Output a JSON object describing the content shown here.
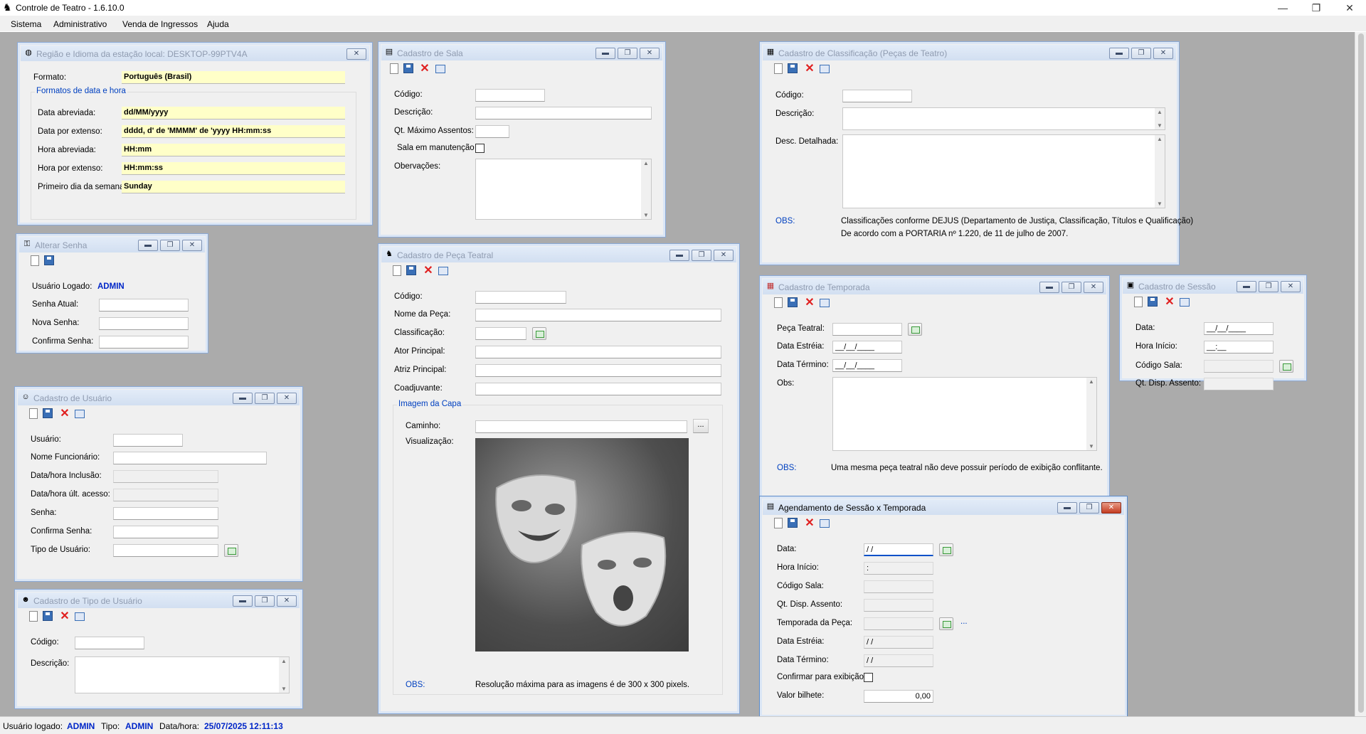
{
  "app": {
    "title": "Controle de Teatro - 1.6.10.0",
    "menu": [
      "Sistema",
      "Administrativo",
      "Venda de Ingressos",
      "Ajuda"
    ]
  },
  "status": {
    "user_label": "Usuário logado:",
    "user": "ADMIN",
    "type_label": "Tipo:",
    "type": "ADMIN",
    "datetime_label": "Data/hora:",
    "datetime": "25/07/2025 12:11:13"
  },
  "regiao": {
    "title": "Região e Idioma da estação local: DESKTOP-99PTV4A",
    "formato_label": "Formato:",
    "formato": "Português (Brasil)",
    "group_title": "Formatos de data e hora",
    "data_abreviada_label": "Data abreviada:",
    "data_abreviada": "dd/MM/yyyy",
    "data_extenso_label": "Data por extenso:",
    "data_extenso": "dddd, d' de 'MMMM' de 'yyyy HH:mm:ss",
    "hora_abreviada_label": "Hora abreviada:",
    "hora_abreviada": "HH:mm",
    "hora_extenso_label": "Hora por extenso:",
    "hora_extenso": "HH:mm:ss",
    "primeiro_dia_label": "Primeiro dia da semana:",
    "primeiro_dia": "Sunday"
  },
  "sala": {
    "title": "Cadastro de Sala",
    "codigo_label": "Código:",
    "descricao_label": "Descrição:",
    "qt_max_label": "Qt. Máximo Assentos:",
    "manutencao_label": "Sala em manutenção",
    "observacoes_label": "Obervações:"
  },
  "classificacao": {
    "title": "Cadastro de Classificação (Peças de Teatro)",
    "codigo_label": "Código:",
    "descricao_label": "Descrição:",
    "desc_detalhada_label": "Desc. Detalhada:",
    "obs_label": "OBS:",
    "obs_line1": "Classificações conforme DEJUS (Departamento de Justiça, Classificação, Títulos e Qualificação)",
    "obs_line2": "De acordo com a PORTARIA nº 1.220, de 11 de julho de 2007."
  },
  "senha": {
    "title": "Alterar Senha",
    "usuario_label": "Usuário Logado:",
    "usuario": "ADMIN",
    "atual_label": "Senha Atual:",
    "nova_label": "Nova Senha:",
    "confirma_label": "Confirma Senha:"
  },
  "peca": {
    "title": "Cadastro de Peça Teatral",
    "codigo_label": "Código:",
    "nome_label": "Nome da Peça:",
    "classificacao_label": "Classificação:",
    "ator_label": "Ator Principal:",
    "atriz_label": "Atriz Principal:",
    "coadjuvante_label": "Coadjuvante:",
    "imagem_group": "Imagem da Capa",
    "caminho_label": "Caminho:",
    "browse": "...",
    "visualizacao_label": "Visualização:",
    "obs_label": "OBS:",
    "obs_text": "Resolução máxima para as imagens é de 300 x 300 pixels."
  },
  "temporada": {
    "title": "Cadastro de Temporada",
    "peca_label": "Peça Teatral:",
    "estreia_label": "Data Estréia:",
    "estreia": "__/__/____",
    "termino_label": "Data Término:",
    "termino": "__/__/____",
    "obs_field_label": "Obs:",
    "obs_label": "OBS:",
    "obs_text": "Uma mesma peça teatral não deve possuir período de exibição conflitante."
  },
  "sessao": {
    "title": "Cadastro de Sessão",
    "data_label": "Data:",
    "data": "__/__/____",
    "hora_label": "Hora Início:",
    "hora": "__:__",
    "codigo_sala_label": "Código Sala:",
    "qt_disp_label": "Qt. Disp. Assento:"
  },
  "usuario": {
    "title": "Cadastro de Usuário",
    "usuario_label": "Usuário:",
    "nome_label": "Nome Funcionário:",
    "inclusao_label": "Data/hora Inclusão:",
    "ult_acesso_label": "Data/hora últ. acesso:",
    "senha_label": "Senha:",
    "confirma_label": "Confirma Senha:",
    "tipo_label": "Tipo de Usuário:"
  },
  "tipo_usuario": {
    "title": "Cadastro de Tipo de Usuário",
    "codigo_label": "Código:",
    "descricao_label": "Descrição:"
  },
  "agendamento": {
    "title": "Agendamento de Sessão x Temporada",
    "data_label": "Data:",
    "data": "/ /",
    "hora_label": "Hora Início:",
    "hora": ":",
    "codigo_sala_label": "Código Sala:",
    "qt_disp_label": "Qt. Disp. Assento:",
    "temporada_label": "Temporada da Peça:",
    "temporada_link": "...",
    "estreia_label": "Data Estréia:",
    "estreia": "/ /",
    "termino_label": "Data Término:",
    "termino": "/ /",
    "confirmar_label": "Confirmar para exibição",
    "valor_label": "Valor bilhete:",
    "valor": "0,00"
  },
  "colors": {
    "mdi_bg": "#ababab",
    "status_blue": "#0026c8",
    "highlight": "#ffffc8"
  }
}
